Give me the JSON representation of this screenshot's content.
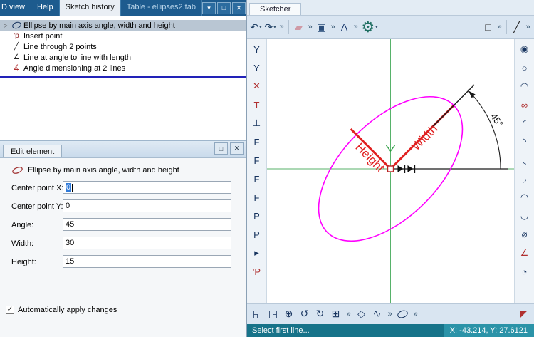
{
  "colors": {
    "titlebar_blue": "#1d5b8e",
    "selection_gray_blue": "#b9c6d3",
    "drop_indicator_blue": "#2222b8",
    "statusbar_teal": "#177389",
    "ellipse": "#ff00ff",
    "dimension_red": "#e02020",
    "axis_green": "#57b26a"
  },
  "history_panel": {
    "expander_glyph": "▷",
    "tabs": [
      {
        "label": "D view"
      },
      {
        "label": "Help"
      },
      {
        "label": "Sketch history"
      },
      {
        "label": "Table - ellipses2.tab"
      }
    ],
    "window_buttons": {
      "menu": "▾",
      "maximize": "□",
      "close": "✕"
    },
    "items": [
      {
        "icon": "ellipse-icon",
        "label": "Ellipse by main axis angle, width and height",
        "selected": true
      },
      {
        "icon": "insert-point-icon",
        "glyph": "'p",
        "label": "Insert point"
      },
      {
        "icon": "line-2-points-icon",
        "glyph": "╱",
        "label": "Line through 2 points"
      },
      {
        "icon": "line-at-angle-icon",
        "glyph": "∠",
        "label": "Line at angle to line with length"
      },
      {
        "icon": "angle-dimension-icon",
        "glyph": "∡",
        "label": "Angle dimensioning at 2 lines"
      }
    ]
  },
  "edit_panel": {
    "title": "Edit element",
    "buttons": {
      "maximize": "□",
      "close": "✕"
    },
    "element_label": "Ellipse by main axis angle, width and height",
    "fields": [
      {
        "label": "Center point X:",
        "value": "0"
      },
      {
        "label": "Center point Y:",
        "value": "0"
      },
      {
        "label": "Angle:",
        "value": "45"
      },
      {
        "label": "Width:",
        "value": "30"
      },
      {
        "label": "Height:",
        "value": "15"
      }
    ],
    "checkbox": {
      "label": "Automatically apply changes",
      "checked": true,
      "check_glyph": "✓"
    }
  },
  "sketcher": {
    "tab": "Sketcher",
    "top_toolbar": [
      {
        "n": "undo-button",
        "g": "↶",
        "dd": true
      },
      {
        "n": "redo-button",
        "g": "↷",
        "dd": true
      },
      {
        "t": "o",
        "n": "undo-overflow",
        "g": "»"
      },
      {
        "t": "s"
      },
      {
        "n": "erase-tool",
        "g": "▰",
        "c": "#cf9aa6"
      },
      {
        "t": "o",
        "n": "erase-overflow",
        "g": "»"
      },
      {
        "n": "copy-tool",
        "g": "▣",
        "c": "#2a4d7a"
      },
      {
        "t": "o",
        "n": "copy-overflow",
        "g": "»"
      },
      {
        "n": "text-tool",
        "g": "A",
        "c": "#1a3a6e"
      },
      {
        "t": "o",
        "n": "text-overflow",
        "g": "»"
      },
      {
        "n": "settings-gear",
        "g": "⚙",
        "c": "#1f6f62",
        "big": true,
        "dd": true
      },
      {
        "t": "g"
      },
      {
        "n": "rectangle-tool",
        "g": "□",
        "c": "#333333"
      },
      {
        "t": "o",
        "n": "rectangle-overflow",
        "g": "»"
      },
      {
        "t": "s"
      },
      {
        "n": "line-tool",
        "g": "╱",
        "c": "#222222"
      },
      {
        "t": "o",
        "n": "line-overflow",
        "g": "»"
      }
    ],
    "left_toolbar": [
      {
        "n": "constraint-y1-tool",
        "g": "Y",
        "c": "#16335e"
      },
      {
        "n": "constraint-y2-tool",
        "g": "Y",
        "c": "#16335e"
      },
      {
        "n": "delete-constraint-tool",
        "g": "✕",
        "c": "#b03030"
      },
      {
        "n": "tangent-tool",
        "g": "T",
        "c": "#b03030"
      },
      {
        "n": "perpendicular-tool",
        "g": "⊥",
        "c": "#16335e"
      },
      {
        "n": "fix-constraint-1-tool",
        "g": "F",
        "c": "#16335e"
      },
      {
        "n": "fix-constraint-2-tool",
        "g": "F",
        "c": "#16335e"
      },
      {
        "n": "fix-constraint-3-tool",
        "g": "F",
        "c": "#16335e"
      },
      {
        "n": "fix-constraint-4-tool",
        "g": "F",
        "c": "#16335e"
      },
      {
        "n": "point-constraint-1-tool",
        "g": "P",
        "c": "#16335e"
      },
      {
        "n": "point-constraint-2-tool",
        "g": "P",
        "c": "#16335e"
      },
      {
        "n": "marker-tool",
        "g": "▸",
        "c": "#16335e"
      },
      {
        "n": "insert-point-tool",
        "g": "'P",
        "c": "#b03030"
      }
    ],
    "right_toolbar": [
      {
        "n": "circle-center-tool",
        "g": "◉",
        "c": "#16335e"
      },
      {
        "n": "circle-tool",
        "g": "○",
        "c": "#16335e"
      },
      {
        "n": "arc-3-point-tool",
        "g": "◠",
        "c": "#16335e"
      },
      {
        "n": "circle-2-point-tool",
        "g": "∞",
        "c": "#b03030"
      },
      {
        "n": "arc-tool-1",
        "g": "◜",
        "c": "#16335e"
      },
      {
        "n": "arc-tool-2",
        "g": "◝",
        "c": "#16335e"
      },
      {
        "n": "arc-tool-3",
        "g": "◟",
        "c": "#16335e"
      },
      {
        "n": "arc-tool-4",
        "g": "◞",
        "c": "#16335e"
      },
      {
        "n": "arc-tool-5",
        "g": "◠",
        "c": "#16335e"
      },
      {
        "n": "arc-tool-6",
        "g": "◡",
        "c": "#16335e"
      },
      {
        "n": "diameter-dimension-tool",
        "g": "⌀",
        "c": "#16335e"
      },
      {
        "n": "angle-dimension-tool",
        "g": "∠",
        "c": "#b03030"
      },
      {
        "n": "radius-dimension-tool",
        "g": "◔",
        "c": "#16335e"
      }
    ],
    "bottom_toolbar": [
      {
        "n": "stretch-tool",
        "g": "◱",
        "c": "#16335e"
      },
      {
        "n": "move-tool",
        "g": "◲",
        "c": "#16335e"
      },
      {
        "n": "snap-center-tool",
        "g": "⊕",
        "c": "#16335e"
      },
      {
        "n": "rotate-ccw-tool",
        "g": "↺",
        "c": "#16335e"
      },
      {
        "n": "rotate-cw-tool",
        "g": "↻",
        "c": "#16335e"
      },
      {
        "n": "grid-snap-tool",
        "g": "⊞",
        "c": "#16335e"
      },
      {
        "t": "o",
        "n": "snap-overflow",
        "g": "»"
      },
      {
        "n": "polygon-tool",
        "g": "◇",
        "c": "#16335e"
      },
      {
        "n": "spline-tool",
        "g": "∿",
        "c": "#16335e"
      },
      {
        "t": "o",
        "n": "spline-overflow",
        "g": "»"
      },
      {
        "n": "ellipse-tool",
        "oval": true
      },
      {
        "t": "o",
        "n": "ellipse-overflow",
        "g": "»"
      },
      {
        "t": "g"
      },
      {
        "n": "corner-tool",
        "g": "◤",
        "c": "#b03030"
      }
    ],
    "canvas": {
      "width_label": "Width",
      "height_label": "Height",
      "angle_label": "45°"
    },
    "status": {
      "message": "Select first line...",
      "coords": "X: -43.214, Y: 27.6121"
    }
  }
}
